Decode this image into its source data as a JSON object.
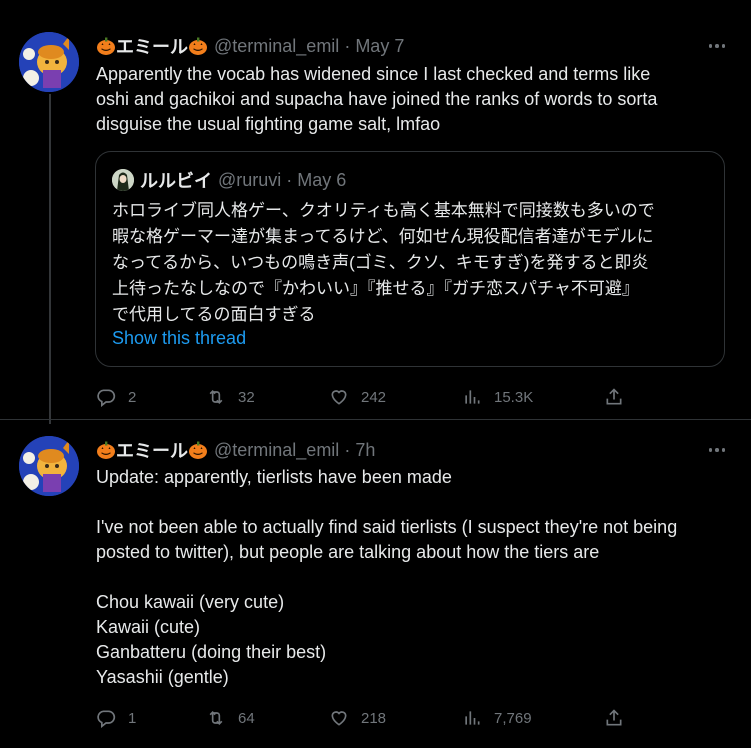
{
  "tweets": [
    {
      "display_name": "エミール",
      "handle": "@terminal_emil",
      "separator": "·",
      "time": "May 7",
      "text": "Apparently the vocab has widened since I last checked and terms like\noshi and gachikoi and supacha have joined the ranks of words to sorta\ndisguise the usual fighting game salt, lmfao",
      "quote": {
        "display_name": "ルルビイ",
        "handle": "@ruruvi",
        "separator": "·",
        "time": "May 6",
        "lines": [
          "ホロライブ同人格ゲー、クオリティも高く基本無料で同接数も多いので",
          "暇な格ゲーマー達が集まってるけど、何如せん現役配信者達がモデルに",
          "なってるから、いつもの鳴き声(ゴミ、クソ、キモすぎ)を発すると即炎",
          "上待ったなしなので『かわいい』『推せる』『ガチ恋スパチャ不可避』",
          "で代用してるの面白すぎる"
        ],
        "show_thread": "Show this thread"
      },
      "actions": {
        "replies": "2",
        "retweets": "32",
        "likes": "242",
        "views": "15.3K"
      }
    },
    {
      "display_name": "エミール",
      "handle": "@terminal_emil",
      "separator": "·",
      "time": "7h",
      "text": "Update: apparently, tierlists have been made\n\nI've not been able to actually find said tierlists (I suspect they're not being\nposted to twitter), but people are talking about how the tiers are\n\nChou kawaii (very cute)\nKawaii (cute)\nGanbatteru (doing their best)\nYasashii (gentle)",
      "actions": {
        "replies": "1",
        "retweets": "64",
        "likes": "218",
        "views": "7,769"
      }
    }
  ],
  "colors": {
    "background": "#000000",
    "text": "#e7e9ea",
    "secondary": "#71767b",
    "link": "#1d9bf0",
    "border": "#2f3336",
    "pumpkin": "#f27e1b"
  }
}
